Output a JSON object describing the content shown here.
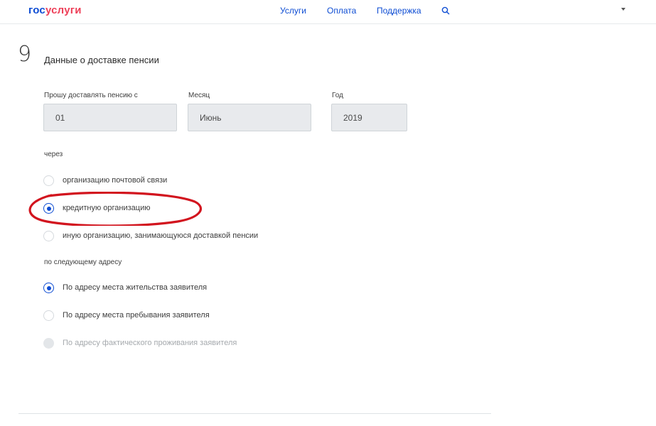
{
  "header": {
    "logo_part1": "гос",
    "logo_part2": "услуги",
    "nav": [
      "Услуги",
      "Оплата",
      "Поддержка"
    ],
    "search_icon": "search-icon",
    "user_menu_icon": "caret-down-icon"
  },
  "step": {
    "number": "9",
    "title": "Данные о доставке пенсии"
  },
  "date_fields": {
    "day": {
      "label": "Прошу доставлять пенсию с",
      "value": "01"
    },
    "month": {
      "label": "Месяц",
      "value": "Июнь"
    },
    "year": {
      "label": "Год",
      "value": "2019"
    }
  },
  "delivery": {
    "label": "через",
    "options": [
      {
        "label": "организацию почтовой связи",
        "checked": false
      },
      {
        "label": "кредитную организацию",
        "checked": true
      },
      {
        "label": "иную организацию, занимающуюся доставкой пенсии",
        "checked": false
      }
    ]
  },
  "address": {
    "label": "по следующему адресу",
    "options": [
      {
        "label": "По адресу места жительства заявителя",
        "checked": true
      },
      {
        "label": "По адресу места пребывания заявителя",
        "checked": false
      },
      {
        "label": "По адресу фактического проживания заявителя",
        "checked": false,
        "disabled": true
      }
    ]
  },
  "colors": {
    "brand_blue": "#0d4cd3",
    "brand_red": "#ee3f58",
    "annotation_red": "#d2141e"
  }
}
